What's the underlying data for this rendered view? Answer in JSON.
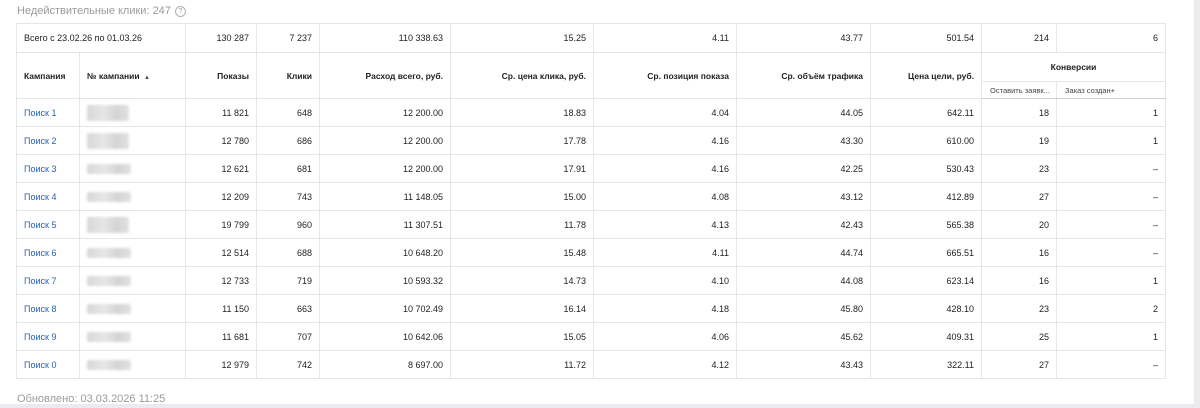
{
  "header": {
    "invalid_clicks": "Недействительные клики: 247",
    "help_icon": "?"
  },
  "footer": {
    "updated": "Обновлено: 03.03.2026 11:25"
  },
  "totals": {
    "label": "Всего с 23.02.26 по 01.03.26",
    "impressions": "130 287",
    "clicks": "7 237",
    "spend": "110 338.63",
    "avg_cpc": "15.25",
    "avg_position": "4.11",
    "traffic_volume": "43.77",
    "goal_price": "501.54",
    "conv_leave_request": "214",
    "conv_order_created": "6"
  },
  "columns": {
    "campaign": "Кампания",
    "campaign_no": "№ кампании",
    "sort_indicator": "▲",
    "impressions": "Показы",
    "clicks": "Клики",
    "spend": "Расход всего, руб.",
    "avg_cpc": "Ср. цена клика, руб.",
    "avg_position": "Ср. позиция показа",
    "traffic_volume": "Ср. объём трафика",
    "goal_price": "Цена цели, руб.",
    "conversions": "Конверсии",
    "conv_leave_request": "Оставить заявк...",
    "conv_order_created": "Заказ создан+"
  },
  "rows": [
    {
      "name": "Поиск 1",
      "impressions": "11 821",
      "clicks": "648",
      "spend": "12 200.00",
      "avg_cpc": "18.83",
      "avg_position": "4.04",
      "traffic_volume": "44.05",
      "goal_price": "642.11",
      "conv1": "18",
      "conv2": "1"
    },
    {
      "name": "Поиск 2",
      "impressions": "12 780",
      "clicks": "686",
      "spend": "12 200.00",
      "avg_cpc": "17.78",
      "avg_position": "4.16",
      "traffic_volume": "43.30",
      "goal_price": "610.00",
      "conv1": "19",
      "conv2": "1"
    },
    {
      "name": "Поиск 3",
      "impressions": "12 621",
      "clicks": "681",
      "spend": "12 200.00",
      "avg_cpc": "17.91",
      "avg_position": "4.16",
      "traffic_volume": "42.25",
      "goal_price": "530.43",
      "conv1": "23",
      "conv2": "–"
    },
    {
      "name": "Поиск 4",
      "impressions": "12 209",
      "clicks": "743",
      "spend": "11 148.05",
      "avg_cpc": "15.00",
      "avg_position": "4.08",
      "traffic_volume": "43.12",
      "goal_price": "412.89",
      "conv1": "27",
      "conv2": "–"
    },
    {
      "name": "Поиск 5",
      "impressions": "19 799",
      "clicks": "960",
      "spend": "11 307.51",
      "avg_cpc": "11.78",
      "avg_position": "4.13",
      "traffic_volume": "42.43",
      "goal_price": "565.38",
      "conv1": "20",
      "conv2": "–"
    },
    {
      "name": "Поиск 6",
      "impressions": "12 514",
      "clicks": "688",
      "spend": "10 648.20",
      "avg_cpc": "15.48",
      "avg_position": "4.11",
      "traffic_volume": "44.74",
      "goal_price": "665.51",
      "conv1": "16",
      "conv2": "–"
    },
    {
      "name": "Поиск 7",
      "impressions": "12 733",
      "clicks": "719",
      "spend": "10 593.32",
      "avg_cpc": "14.73",
      "avg_position": "4.10",
      "traffic_volume": "44.08",
      "goal_price": "623.14",
      "conv1": "16",
      "conv2": "1"
    },
    {
      "name": "Поиск 8",
      "impressions": "11 150",
      "clicks": "663",
      "spend": "10 702.49",
      "avg_cpc": "16.14",
      "avg_position": "4.18",
      "traffic_volume": "45.80",
      "goal_price": "428.10",
      "conv1": "23",
      "conv2": "2"
    },
    {
      "name": "Поиск 9",
      "impressions": "11 681",
      "clicks": "707",
      "spend": "10 642.06",
      "avg_cpc": "15.05",
      "avg_position": "4.06",
      "traffic_volume": "45.62",
      "goal_price": "409.31",
      "conv1": "25",
      "conv2": "1"
    },
    {
      "name": "Поиск 0",
      "impressions": "12 979",
      "clicks": "742",
      "spend": "8 697.00",
      "avg_cpc": "11.72",
      "avg_position": "4.12",
      "traffic_volume": "43.43",
      "goal_price": "322.11",
      "conv1": "27",
      "conv2": "–"
    }
  ]
}
